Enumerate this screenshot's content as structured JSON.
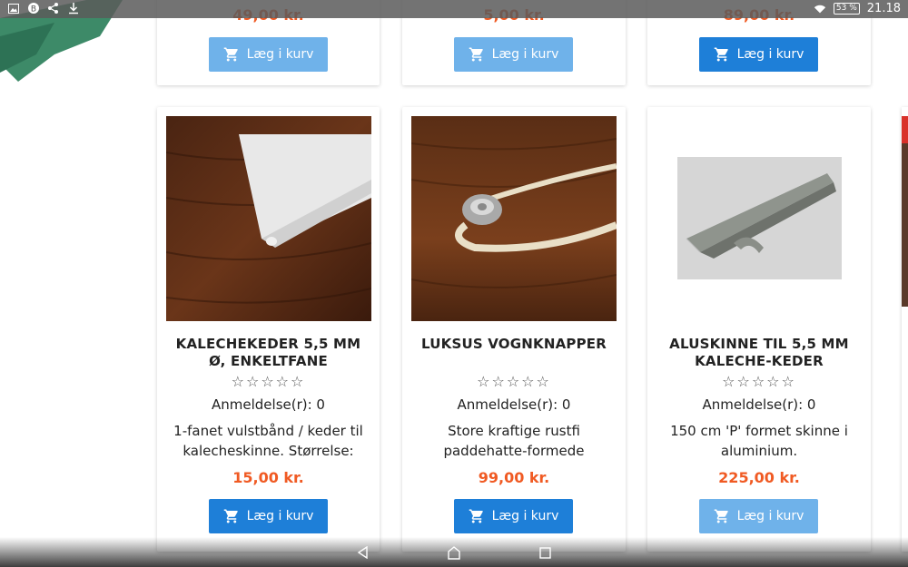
{
  "status_bar": {
    "icons": [
      "image-icon",
      "sync-icon",
      "share-icon",
      "download-icon"
    ],
    "battery": "53 %",
    "time": "21.18"
  },
  "top_row": [
    {
      "price": "49,00 kr.",
      "button_label": "Læg i kurv",
      "button_style": "light"
    },
    {
      "price": "5,00 kr.",
      "button_label": "Læg i kurv",
      "button_style": "light"
    },
    {
      "price": "89,00 kr.",
      "button_label": "Læg i kurv",
      "button_style": "dark"
    }
  ],
  "products": [
    {
      "title": "KALECHEKEDER 5,5 MM Ø, ENKELTFANE",
      "stars": "☆☆☆☆☆",
      "reviews": "Anmeldelse(r): 0",
      "desc_line1": "1-fanet vulstbånd / keder til",
      "desc_line2": "kalecheskinne. Størrelse:",
      "price": "15,00 kr.",
      "button_label": "Læg i kurv",
      "button_style": "dark"
    },
    {
      "title": "LUKSUS VOGNKNAPPER",
      "stars": "☆☆☆☆☆",
      "reviews": "Anmeldelse(r): 0",
      "desc_line1": "Store kraftige rustfi",
      "desc_line2": "paddehatte-formede",
      "price": "99,00 kr.",
      "button_label": "Læg i kurv",
      "button_style": "dark"
    },
    {
      "title": "ALUSKINNE TIL 5,5 MM KALECHE-KEDER",
      "stars": "☆☆☆☆☆",
      "reviews": "Anmeldelse(r): 0",
      "desc_line1": "150 cm 'P' formet skinne i",
      "desc_line2": "aluminium.",
      "price": "225,00 kr.",
      "button_label": "Læg i kurv",
      "button_style": "light"
    }
  ],
  "colors": {
    "price": "#f05a23",
    "button_dark": "#1e7fd8",
    "button_light": "#6fb2ea"
  },
  "nav": {
    "icons": [
      "back-icon",
      "home-icon",
      "recents-icon"
    ]
  }
}
